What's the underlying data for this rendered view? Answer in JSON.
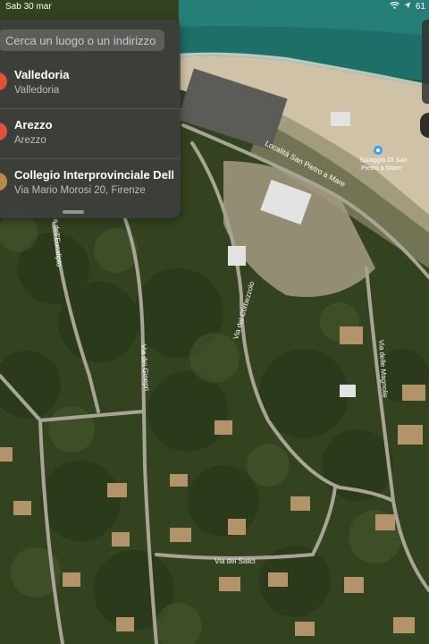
{
  "status_bar": {
    "time": "Sab 30 mar",
    "battery": "61"
  },
  "search": {
    "placeholder": "Cerca un luogo o un indirizzo"
  },
  "results": [
    {
      "title": "Valledoria",
      "subtitle": "Valledoria",
      "color": "#e0503a"
    },
    {
      "title": "Arezzo",
      "subtitle": "Arezzo",
      "color": "#e0503a"
    },
    {
      "title": "Collegio Interprovinciale Delle...",
      "subtitle": "Via Mario Morosi 20, Firenze",
      "color": "#b98a4e"
    }
  ],
  "map": {
    "road_labels": {
      "localita": "Località San Pietro a Mare",
      "eucalipto": "a dell'Eucalipto",
      "ginepri": "Via dei Ginepri",
      "corbezzolo": "Via del Corbezzolo",
      "magnolie": "Via delle Magnolie",
      "salici": "Via dei Salici"
    },
    "poi": {
      "name_line1": "Spiaggia Di San",
      "name_line2": "Pietro a Mare"
    }
  }
}
